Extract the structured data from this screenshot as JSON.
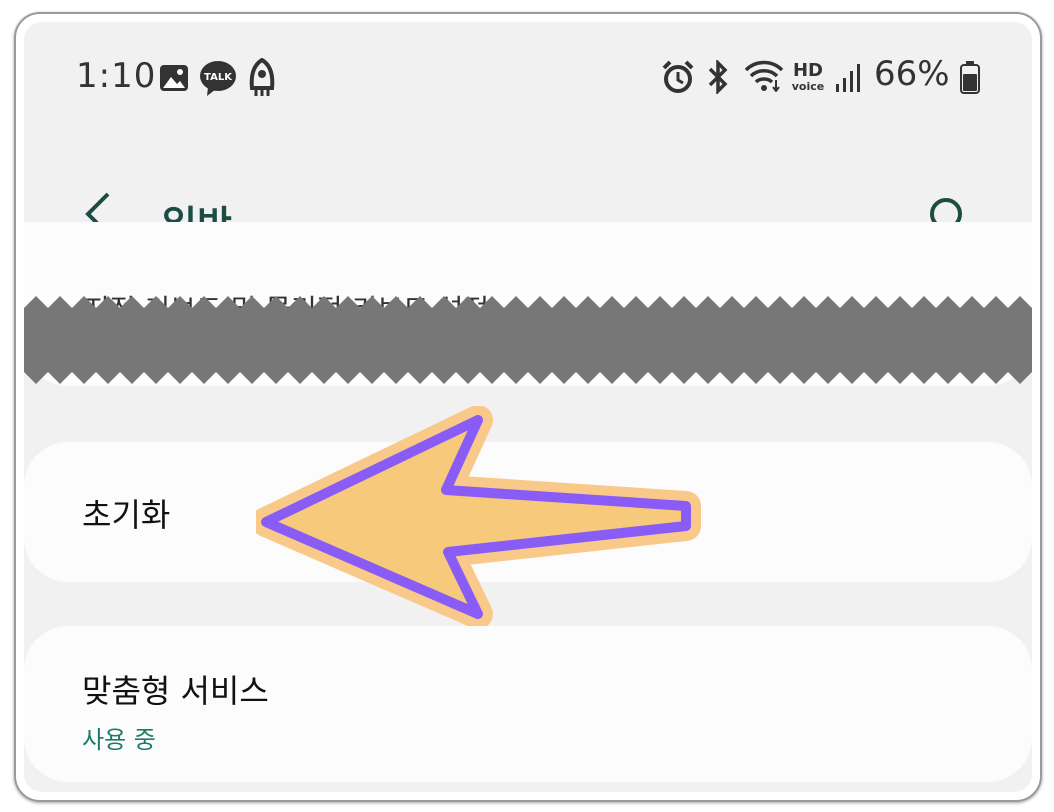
{
  "status_bar": {
    "time": "1:10",
    "icons_left": [
      "gallery-icon",
      "kakaotalk-icon",
      "rocket-icon"
    ],
    "kakaotalk_label": "TALK",
    "icons_right": [
      "alarm-icon",
      "bluetooth-icon",
      "wifi-icon",
      "hd-voice-icon",
      "signal-icon",
      "battery-icon"
    ],
    "hd_voice_label_top": "HD",
    "hd_voice_label_bottom": "voice",
    "battery_percent": "66%"
  },
  "app_bar": {
    "title": "일반",
    "back_icon": "chevron-left-icon",
    "search_icon": "search-icon"
  },
  "list": {
    "partial_item_label": "지정 키보드 및 물리적 키보드 설정",
    "items": [
      {
        "label": "초기화",
        "sublabel": ""
      },
      {
        "label": "맞춤형 서비스",
        "sublabel": "사용 중"
      }
    ]
  },
  "colors": {
    "accent": "#1f7a6a",
    "title": "#1b4d42",
    "arrow_fill": "#f7c97a",
    "arrow_stroke": "#8a5cf6",
    "arrow_outline": "#f9c98a"
  }
}
